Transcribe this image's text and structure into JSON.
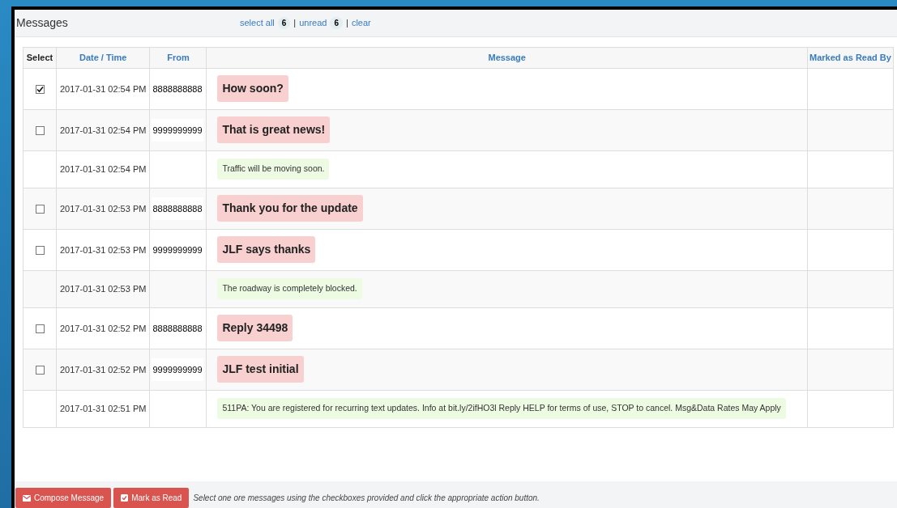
{
  "panel": {
    "title": "Messages",
    "select_all": "select all",
    "select_all_count": "6",
    "separator_1": "|",
    "unread": "unread",
    "unread_count": "6",
    "separator_2": "|",
    "clear": "clear"
  },
  "table": {
    "columns": [
      "Select",
      "Date / Time",
      "From",
      "Message",
      "Marked as Read By"
    ],
    "rows": [
      {
        "kind": "incoming",
        "checked": true,
        "datetime": "2017-01-31 02:54 PM",
        "from": "8888888888",
        "message": "How soon?"
      },
      {
        "kind": "incoming",
        "checked": false,
        "datetime": "2017-01-31 02:54 PM",
        "from": "9999999999",
        "message": "That is great news!"
      },
      {
        "kind": "outgoing",
        "datetime": "2017-01-31 02:54 PM",
        "message": "Traffic will be moving soon."
      },
      {
        "kind": "incoming",
        "checked": false,
        "datetime": "2017-01-31 02:53 PM",
        "from": "8888888888",
        "message": "Thank you for the update"
      },
      {
        "kind": "incoming",
        "checked": false,
        "datetime": "2017-01-31 02:53 PM",
        "from": "9999999999",
        "message": "JLF says thanks"
      },
      {
        "kind": "outgoing",
        "datetime": "2017-01-31 02:53 PM",
        "message": "The roadway is completely blocked."
      },
      {
        "kind": "incoming",
        "checked": false,
        "datetime": "2017-01-31 02:52 PM",
        "from": "8888888888",
        "message": "Reply 34498"
      },
      {
        "kind": "incoming",
        "checked": false,
        "datetime": "2017-01-31 02:52 PM",
        "from": "9999999999",
        "message": "JLF test initial"
      },
      {
        "kind": "outgoing",
        "datetime": "2017-01-31 02:51 PM",
        "message": "511PA: You are registered for recurring text updates. Info at bit.ly/2ifHO3l Reply HELP for terms of use, STOP to cancel. Msg&Data Rates May Apply"
      }
    ]
  },
  "footer": {
    "buttons": [
      "Compose Message",
      "Mark as Read"
    ],
    "hint": "Select one ore messages using the checkboxes provided and click the appropriate action button."
  }
}
